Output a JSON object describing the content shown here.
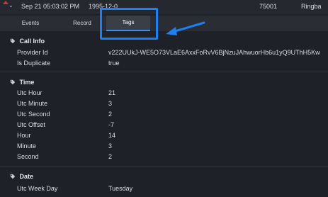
{
  "top_row": {
    "datetime": "Sep 21 05:03:02 PM",
    "code_a": "1995-12-0",
    "code_b": "75001",
    "code_c": "Ringba"
  },
  "tabs": [
    {
      "label": "Events"
    },
    {
      "label": "Record"
    },
    {
      "label": "Tags"
    }
  ],
  "active_tab": "Tags",
  "sections": {
    "call_info": {
      "title": "Call Info",
      "rows": [
        {
          "label": "Provider Id",
          "value": "v222UUkJ-WE5O73VLaE6AxxFoRvV6BjNzuJAhwuorHb6u1yQ9UThH5Kw"
        },
        {
          "label": "Is Duplicate",
          "value": "true"
        }
      ]
    },
    "time": {
      "title": "Time",
      "rows": [
        {
          "label": "Utc Hour",
          "value": "21"
        },
        {
          "label": "Utc Minute",
          "value": "3"
        },
        {
          "label": "Utc Second",
          "value": "2"
        },
        {
          "label": "Utc Offset",
          "value": "-7"
        },
        {
          "label": "Hour",
          "value": "14"
        },
        {
          "label": "Minute",
          "value": "3"
        },
        {
          "label": "Second",
          "value": "2"
        }
      ]
    },
    "date": {
      "title": "Date",
      "rows": [
        {
          "label": "Utc Week Day",
          "value": "Tuesday"
        }
      ]
    }
  },
  "icons": {
    "section_icon": "tag-icon",
    "expand_icon": "chevron-down-icon",
    "row_marker": "triangle-icon"
  },
  "colors": {
    "background": "#1e2127",
    "highlight": "#1d7ff0",
    "active_tab_underline": "#3f8ee8",
    "marker": "#c53b3b"
  }
}
